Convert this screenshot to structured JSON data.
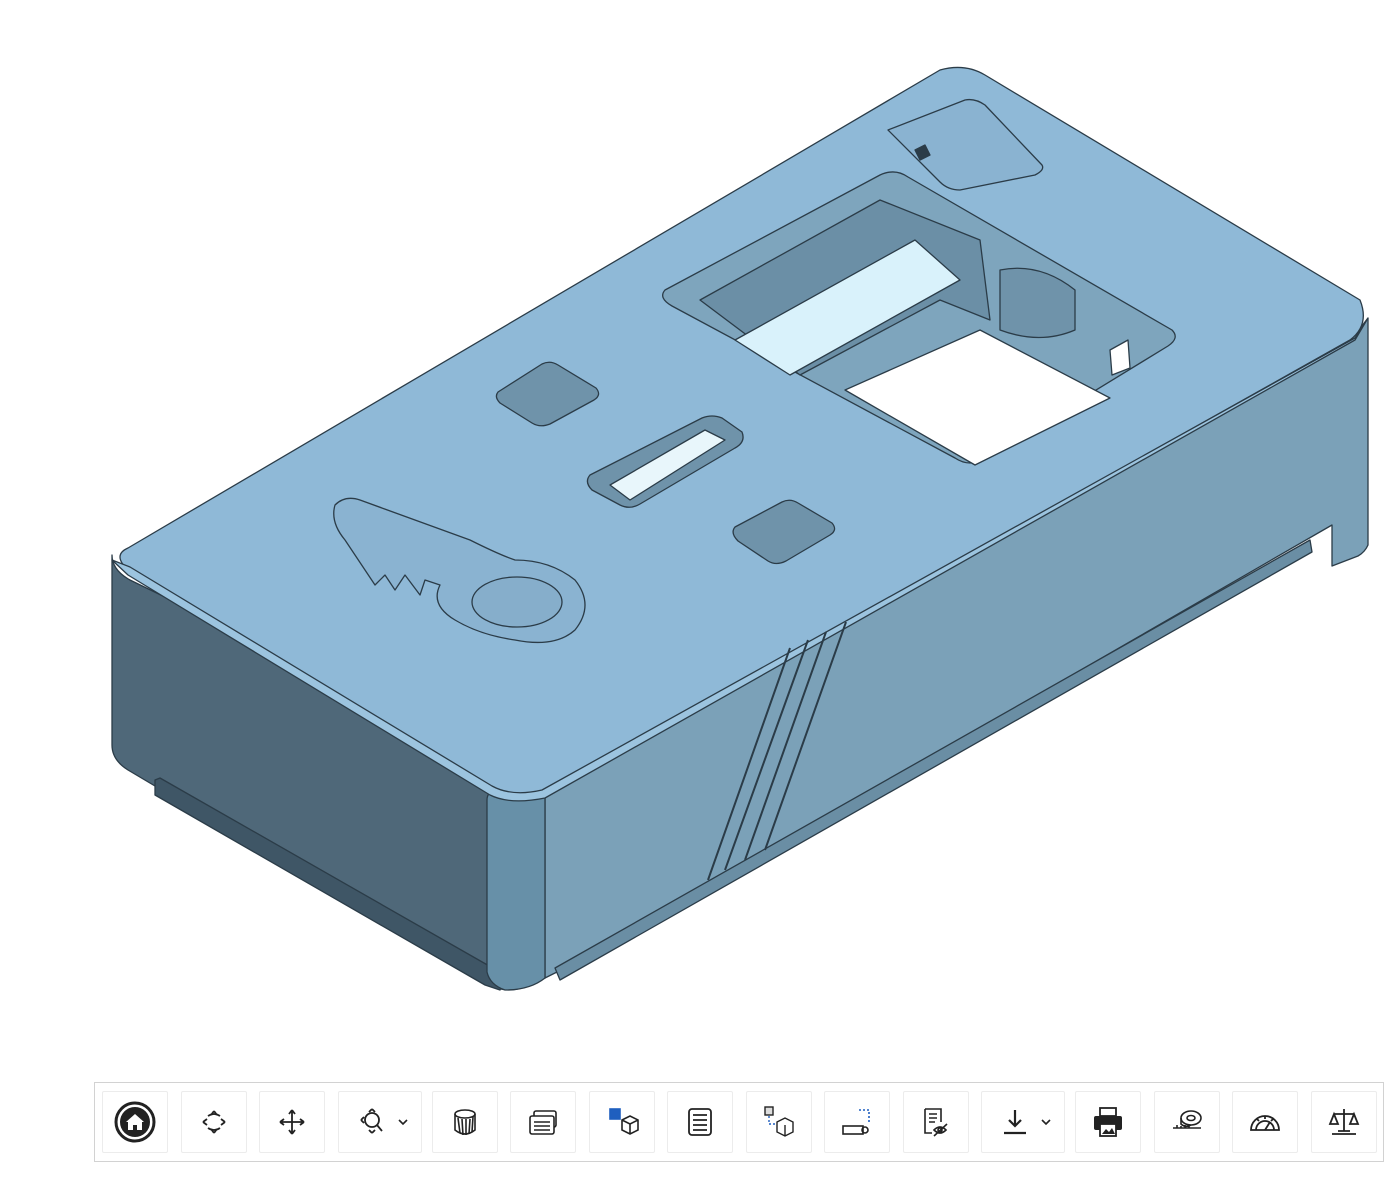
{
  "viewer": {
    "model_color": "#8fb8d6",
    "top_color": "#8fb9d7",
    "front_color": "#7ba1b8",
    "side_color": "#4f6879",
    "edge_color": "#2b3c48"
  },
  "toolbar": {
    "tools": [
      {
        "name": "home-view",
        "icon": "home-icon"
      },
      {
        "name": "rotate",
        "icon": "rotate-arrows-icon"
      },
      {
        "name": "pan",
        "icon": "pan-move-icon"
      },
      {
        "name": "zoom",
        "icon": "zoom-icon",
        "dropdown": true
      },
      {
        "name": "section-view",
        "icon": "section-cylinder-icon"
      },
      {
        "name": "layers",
        "icon": "stacked-sheets-icon"
      },
      {
        "name": "view-cube",
        "icon": "grid-cube-icon"
      },
      {
        "name": "parts-list",
        "icon": "list-icon"
      },
      {
        "name": "explode",
        "icon": "explode-parts-icon"
      },
      {
        "name": "measure-distance",
        "icon": "dimension-icon"
      },
      {
        "name": "markup",
        "icon": "eye-notes-icon"
      },
      {
        "name": "download",
        "icon": "download-icon",
        "dropdown": true
      },
      {
        "name": "print",
        "icon": "printer-icon"
      },
      {
        "name": "tape-measure",
        "icon": "tape-measure-icon"
      },
      {
        "name": "protractor",
        "icon": "protractor-icon"
      },
      {
        "name": "mass-properties",
        "icon": "scale-balance-icon"
      }
    ]
  }
}
